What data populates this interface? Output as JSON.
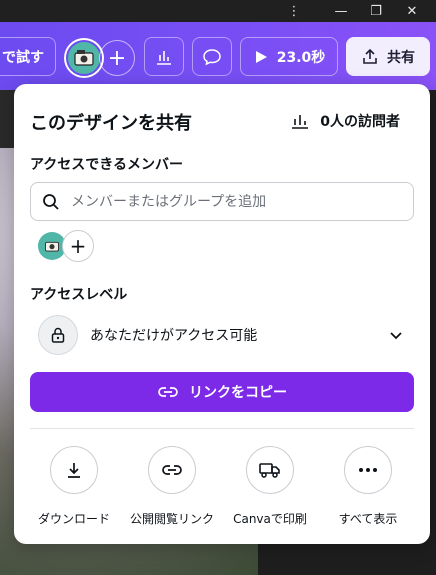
{
  "window": {
    "more_icon": "⋮",
    "minimize_icon": "—",
    "restore_icon": "❐",
    "close_icon": "✕"
  },
  "topbar": {
    "try_label": "で試す",
    "add_label": "+",
    "present_label": "23.0秒",
    "share_label": "共有"
  },
  "panel": {
    "title": "このデザインを共有",
    "visitors_label": "0人の訪問者",
    "access_members_label": "アクセスできるメンバー",
    "search_placeholder": "メンバーまたはグループを追加",
    "member_add": "+",
    "access_level_label": "アクセスレベル",
    "access_level_value": "あなただけがアクセス可能",
    "copy_link_label": "リンクをコピー",
    "actions": [
      {
        "label": "ダウンロード",
        "icon": "download-icon"
      },
      {
        "label": "公開閲覧リンク",
        "icon": "link-icon"
      },
      {
        "label": "Canvaで印刷",
        "icon": "truck-icon"
      },
      {
        "label": "すべて表示",
        "icon": "more-icon"
      }
    ]
  },
  "colors": {
    "brand_purple": "#7d2ae8",
    "topbar_start": "#6c4bf0",
    "share_bg": "#f3eefe"
  }
}
